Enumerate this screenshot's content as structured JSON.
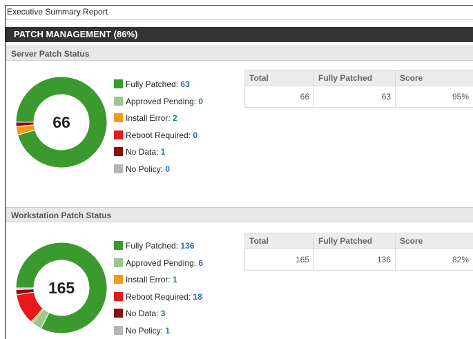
{
  "report_title": "Executive Summary Report",
  "section_header": "PATCH MANAGEMENT (86%)",
  "colors": {
    "fully_patched": "#3a9a2d",
    "approved_pending": "#9bc98a",
    "install_error": "#f39a1b",
    "reboot_required": "#e8181f",
    "no_data": "#8a0f0f",
    "no_policy": "#b5b5b5"
  },
  "server": {
    "title": "Server Patch Status",
    "total": "66",
    "legend": [
      {
        "key": "fully_patched",
        "label": "Fully Patched:",
        "count": "63"
      },
      {
        "key": "approved_pending",
        "label": "Approved Pending:",
        "count": "0"
      },
      {
        "key": "install_error",
        "label": "Install Error:",
        "count": "2"
      },
      {
        "key": "reboot_required",
        "label": "Reboot Required:",
        "count": "0"
      },
      {
        "key": "no_data",
        "label": "No Data:",
        "count": "1"
      },
      {
        "key": "no_policy",
        "label": "No Policy:",
        "count": "0"
      }
    ],
    "table": {
      "headers": [
        "Total",
        "Fully Patched",
        "Score"
      ],
      "row": [
        "66",
        "63",
        "95%"
      ]
    }
  },
  "workstation": {
    "title": "Workstation Patch Status",
    "total": "165",
    "legend": [
      {
        "key": "fully_patched",
        "label": "Fully Patched:",
        "count": "136"
      },
      {
        "key": "approved_pending",
        "label": "Approved Pending:",
        "count": "6"
      },
      {
        "key": "install_error",
        "label": "Install Error:",
        "count": "1"
      },
      {
        "key": "reboot_required",
        "label": "Reboot Required:",
        "count": "18"
      },
      {
        "key": "no_data",
        "label": "No Data:",
        "count": "3"
      },
      {
        "key": "no_policy",
        "label": "No Policy:",
        "count": "1"
      }
    ],
    "table": {
      "headers": [
        "Total",
        "Fully Patched",
        "Score"
      ],
      "row": [
        "165",
        "136",
        "82%"
      ]
    }
  }
}
